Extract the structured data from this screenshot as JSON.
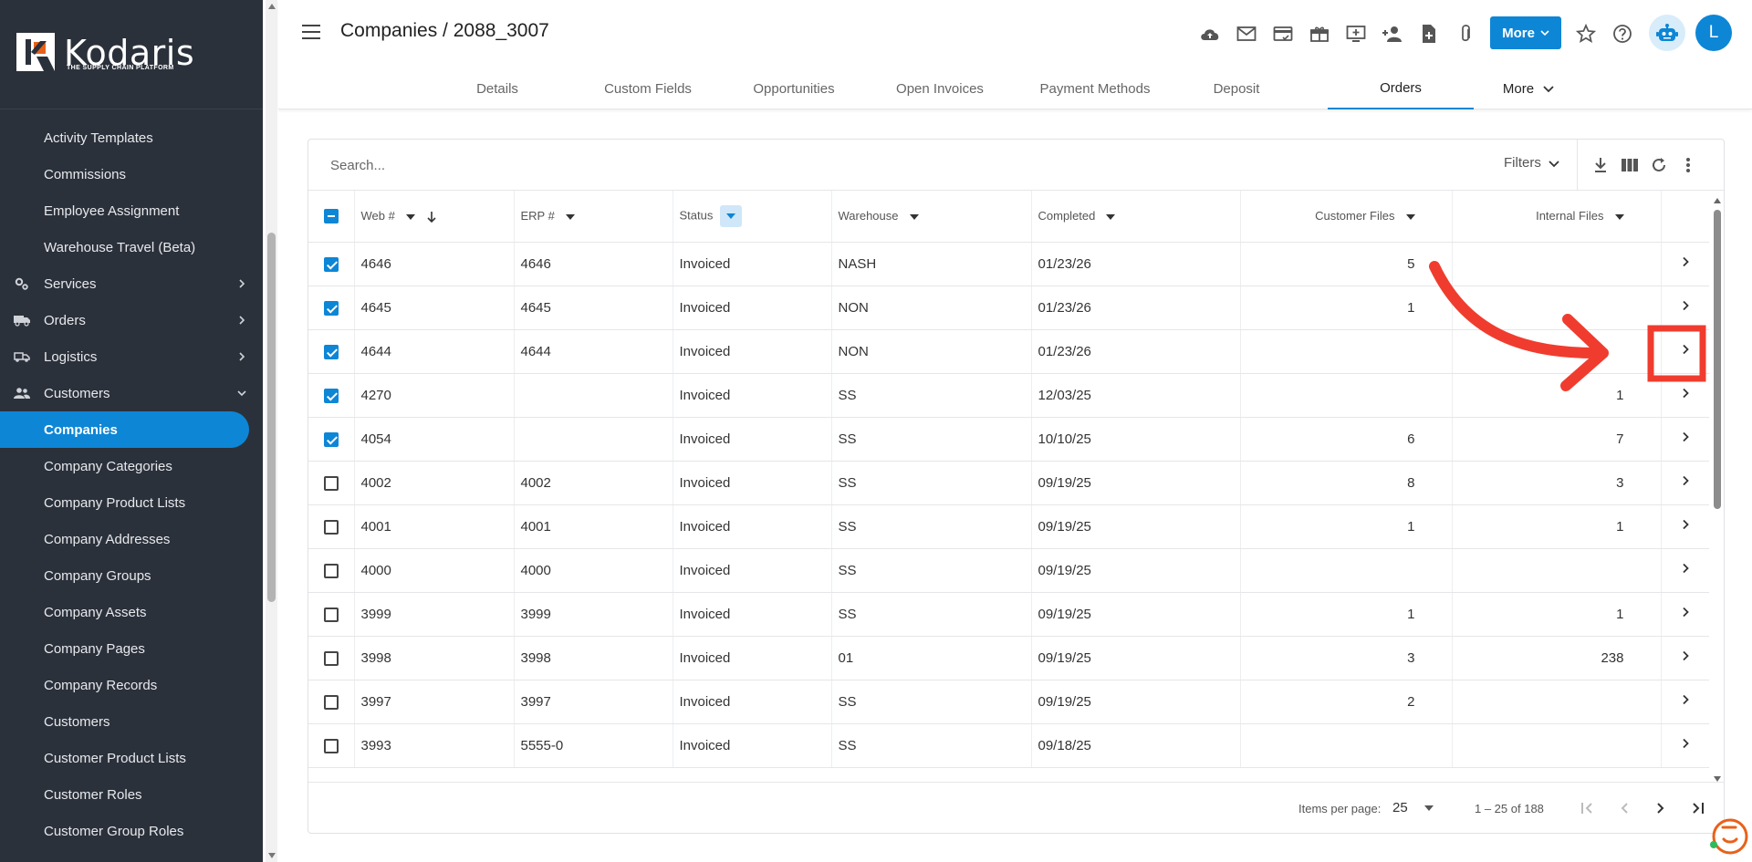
{
  "brand": {
    "name": "Kodaris",
    "tagline": "THE SUPPLY CHAIN PLATFORM"
  },
  "sidebar": {
    "items": [
      {
        "label": "Activity Templates"
      },
      {
        "label": "Commissions"
      },
      {
        "label": "Employee Assignment"
      },
      {
        "label": "Warehouse Travel (Beta)"
      },
      {
        "label": "Services",
        "icon": "gears-icon"
      },
      {
        "label": "Orders",
        "icon": "truck-icon"
      },
      {
        "label": "Logistics",
        "icon": "shipping-truck-icon"
      },
      {
        "label": "Customers",
        "icon": "people-icon"
      },
      {
        "label": "Companies",
        "active": true
      },
      {
        "label": "Company Categories"
      },
      {
        "label": "Company Product Lists"
      },
      {
        "label": "Company Addresses"
      },
      {
        "label": "Company Groups"
      },
      {
        "label": "Company Assets"
      },
      {
        "label": "Company Pages"
      },
      {
        "label": "Company Records"
      },
      {
        "label": "Customers"
      },
      {
        "label": "Customer Product Lists"
      },
      {
        "label": "Customer Roles"
      },
      {
        "label": "Customer Group Roles"
      }
    ]
  },
  "header": {
    "title": "Companies / 2088_3007",
    "more_label": "More",
    "avatar_initial": "L",
    "tabs": [
      {
        "label": "Details"
      },
      {
        "label": "Custom Fields"
      },
      {
        "label": "Opportunities"
      },
      {
        "label": "Open Invoices"
      },
      {
        "label": "Payment Methods"
      },
      {
        "label": "Deposit"
      },
      {
        "label": "Orders",
        "active": true
      },
      {
        "label": "More"
      }
    ]
  },
  "table": {
    "search_placeholder": "Search...",
    "filters_label": "Filters",
    "columns": [
      "Web #",
      "ERP #",
      "Status",
      "Warehouse",
      "Completed",
      "Customer Files",
      "Internal Files"
    ],
    "rows": [
      {
        "checked": true,
        "web": "4646",
        "erp": "4646",
        "status": "Invoiced",
        "warehouse": "NASH",
        "completed": "01/23/26",
        "customer_files": "5",
        "internal_files": ""
      },
      {
        "checked": true,
        "web": "4645",
        "erp": "4645",
        "status": "Invoiced",
        "warehouse": "NON",
        "completed": "01/23/26",
        "customer_files": "1",
        "internal_files": ""
      },
      {
        "checked": true,
        "web": "4644",
        "erp": "4644",
        "status": "Invoiced",
        "warehouse": "NON",
        "completed": "01/23/26",
        "customer_files": "",
        "internal_files": ""
      },
      {
        "checked": true,
        "web": "4270",
        "erp": "",
        "status": "Invoiced",
        "warehouse": "SS",
        "completed": "12/03/25",
        "customer_files": "",
        "internal_files": "1"
      },
      {
        "checked": true,
        "web": "4054",
        "erp": "",
        "status": "Invoiced",
        "warehouse": "SS",
        "completed": "10/10/25",
        "customer_files": "6",
        "internal_files": "7"
      },
      {
        "checked": false,
        "web": "4002",
        "erp": "4002",
        "status": "Invoiced",
        "warehouse": "SS",
        "completed": "09/19/25",
        "customer_files": "8",
        "internal_files": "3"
      },
      {
        "checked": false,
        "web": "4001",
        "erp": "4001",
        "status": "Invoiced",
        "warehouse": "SS",
        "completed": "09/19/25",
        "customer_files": "1",
        "internal_files": "1"
      },
      {
        "checked": false,
        "web": "4000",
        "erp": "4000",
        "status": "Invoiced",
        "warehouse": "SS",
        "completed": "09/19/25",
        "customer_files": "",
        "internal_files": ""
      },
      {
        "checked": false,
        "web": "3999",
        "erp": "3999",
        "status": "Invoiced",
        "warehouse": "SS",
        "completed": "09/19/25",
        "customer_files": "1",
        "internal_files": "1"
      },
      {
        "checked": false,
        "web": "3998",
        "erp": "3998",
        "status": "Invoiced",
        "warehouse": "01",
        "completed": "09/19/25",
        "customer_files": "3",
        "internal_files": "238"
      },
      {
        "checked": false,
        "web": "3997",
        "erp": "3997",
        "status": "Invoiced",
        "warehouse": "SS",
        "completed": "09/19/25",
        "customer_files": "2",
        "internal_files": ""
      },
      {
        "checked": false,
        "web": "3993",
        "erp": "5555-0",
        "status": "Invoiced",
        "warehouse": "SS",
        "completed": "09/18/25",
        "customer_files": "",
        "internal_files": ""
      }
    ]
  },
  "paginator": {
    "items_per_page_label": "Items per page:",
    "page_size": "25",
    "range": "1 – 25 of 188"
  },
  "colors": {
    "accent": "#0d86d6",
    "sidebar_bg": "#2b313b",
    "annotation_red": "#f03c2e"
  }
}
